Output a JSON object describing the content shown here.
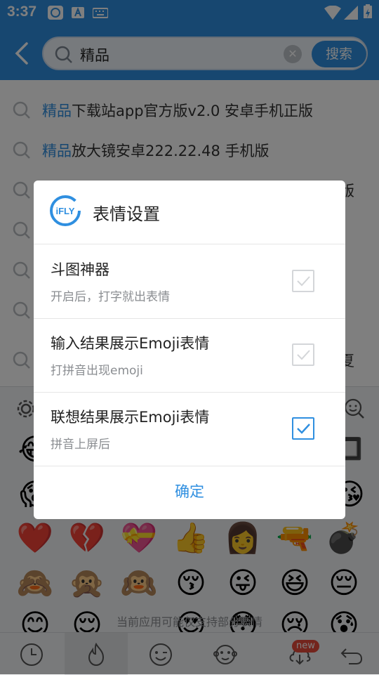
{
  "status_bar": {
    "time": "3:37"
  },
  "search": {
    "value": "精品",
    "button_label": "搜索"
  },
  "suggestions": [
    {
      "highlight": "精品",
      "rest": "下载站app官方版v2.0 安卓手机正版"
    },
    {
      "highlight": "精品",
      "rest": "放大镜安卓222.22.48 手机版"
    },
    {
      "highlight": "",
      "rest": "版"
    },
    {
      "highlight": "",
      "rest": ""
    },
    {
      "highlight": "",
      "rest": ""
    },
    {
      "highlight": "",
      "rest": ""
    },
    {
      "highlight": "",
      "rest": "夏"
    }
  ],
  "emoji_rows": [
    [
      "😂",
      "",
      "",
      "",
      "",
      "",
      "🔲"
    ],
    [
      "😱",
      "",
      "",
      "",
      "",
      "",
      "😘"
    ],
    [
      "❤️",
      "💔",
      "💝",
      "👍",
      "👩",
      "🔫",
      "💣"
    ],
    [
      "🙈",
      "🙊",
      "🙉",
      "😚",
      "😜",
      "😆",
      "😔"
    ],
    [
      "😊",
      "😌",
      "😍",
      "😳",
      "😵",
      "😢",
      "😰"
    ]
  ],
  "keyboard_notice": "当前应用可能仅支持部分表情",
  "bottom_bar": {
    "new_badge": "new"
  },
  "dialog": {
    "logo_text": "iFLY",
    "title": "表情设置",
    "options": [
      {
        "title": "斗图神器",
        "subtitle": "开启后，打字就出表情",
        "checked": false
      },
      {
        "title": "输入结果展示Emoji表情",
        "subtitle": "打拼音出现emoji",
        "checked": false
      },
      {
        "title": "联想结果展示Emoji表情",
        "subtitle": "拼音上屏后",
        "checked": true
      }
    ],
    "confirm_label": "确定"
  },
  "colors": {
    "accent": "#2f8fe0",
    "overlay": "rgba(0,0,0,0.5)",
    "badge": "#e64a3b"
  }
}
